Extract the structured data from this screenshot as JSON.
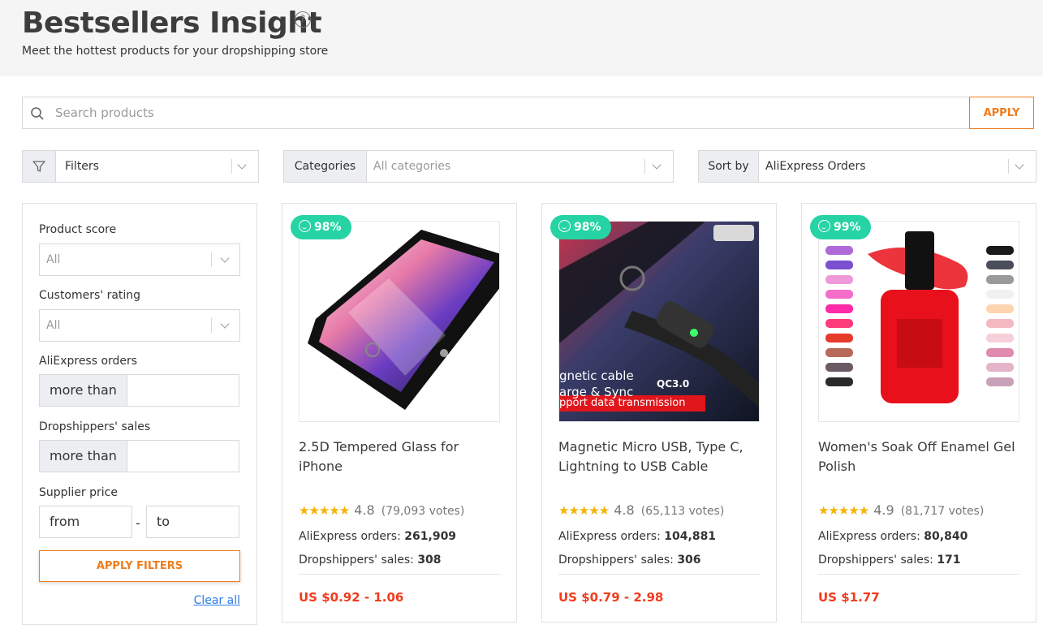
{
  "header": {
    "title": "Bestsellers Insight",
    "help_icon": "?",
    "subtitle": "Meet the hottest products for your dropshipping store"
  },
  "search": {
    "placeholder": "Search products",
    "apply_label": "APPLY"
  },
  "toolbar": {
    "filters_label": "Filters",
    "categories_label": "Categories",
    "categories_value": "All categories",
    "sort_label": "Sort by",
    "sort_value": "AliExpress Orders"
  },
  "filters": {
    "product_score_label": "Product score",
    "product_score_value": "All",
    "rating_label": "Customers' rating",
    "rating_value": "All",
    "orders_label": "AliExpress orders",
    "orders_prefix": "more than",
    "sales_label": "Dropshippers' sales",
    "sales_prefix": "more than",
    "price_label": "Supplier price",
    "price_from": "from",
    "price_dash": "-",
    "price_to": "to",
    "apply_label": "APPLY FILTERS",
    "clear_label": "Clear all"
  },
  "products": [
    {
      "score": "98%",
      "name": "2.5D Tempered Glass for iPhone",
      "stars": "★★★★★",
      "rating": "4.8",
      "votes": "(79,093 votes)",
      "orders_label": "AliExpress orders:",
      "orders": "261,909",
      "sales_label": "Dropshippers' sales:",
      "sales": "308",
      "price": "US $0.92 - 1.06"
    },
    {
      "score": "98%",
      "name": "Magnetic Micro USB, Type C, Lightning to USB Cable",
      "stars": "★★★★★",
      "rating": "4.8",
      "votes": "(65,113 votes)",
      "orders_label": "AliExpress orders:",
      "orders": "104,881",
      "sales_label": "Dropshippers' sales:",
      "sales": "306",
      "price": "US $0.79 - 2.98",
      "image_text": [
        "gnetic cable",
        "arge & Sync",
        "QC3.0",
        "pport data transmission"
      ]
    },
    {
      "score": "99%",
      "name": "Women's Soak Off Enamel Gel Polish",
      "stars": "★★★★★",
      "rating": "4.9",
      "votes": "(81,717 votes)",
      "orders_label": "AliExpress orders:",
      "orders": "80,840",
      "sales_label": "Dropshippers' sales:",
      "sales": "171",
      "price": "US $1.77"
    }
  ],
  "colors": {
    "accent": "#f07c1b",
    "badge": "#26d3a4",
    "price": "#f23b1c",
    "link": "#2b7de9",
    "star": "#f5b300"
  }
}
